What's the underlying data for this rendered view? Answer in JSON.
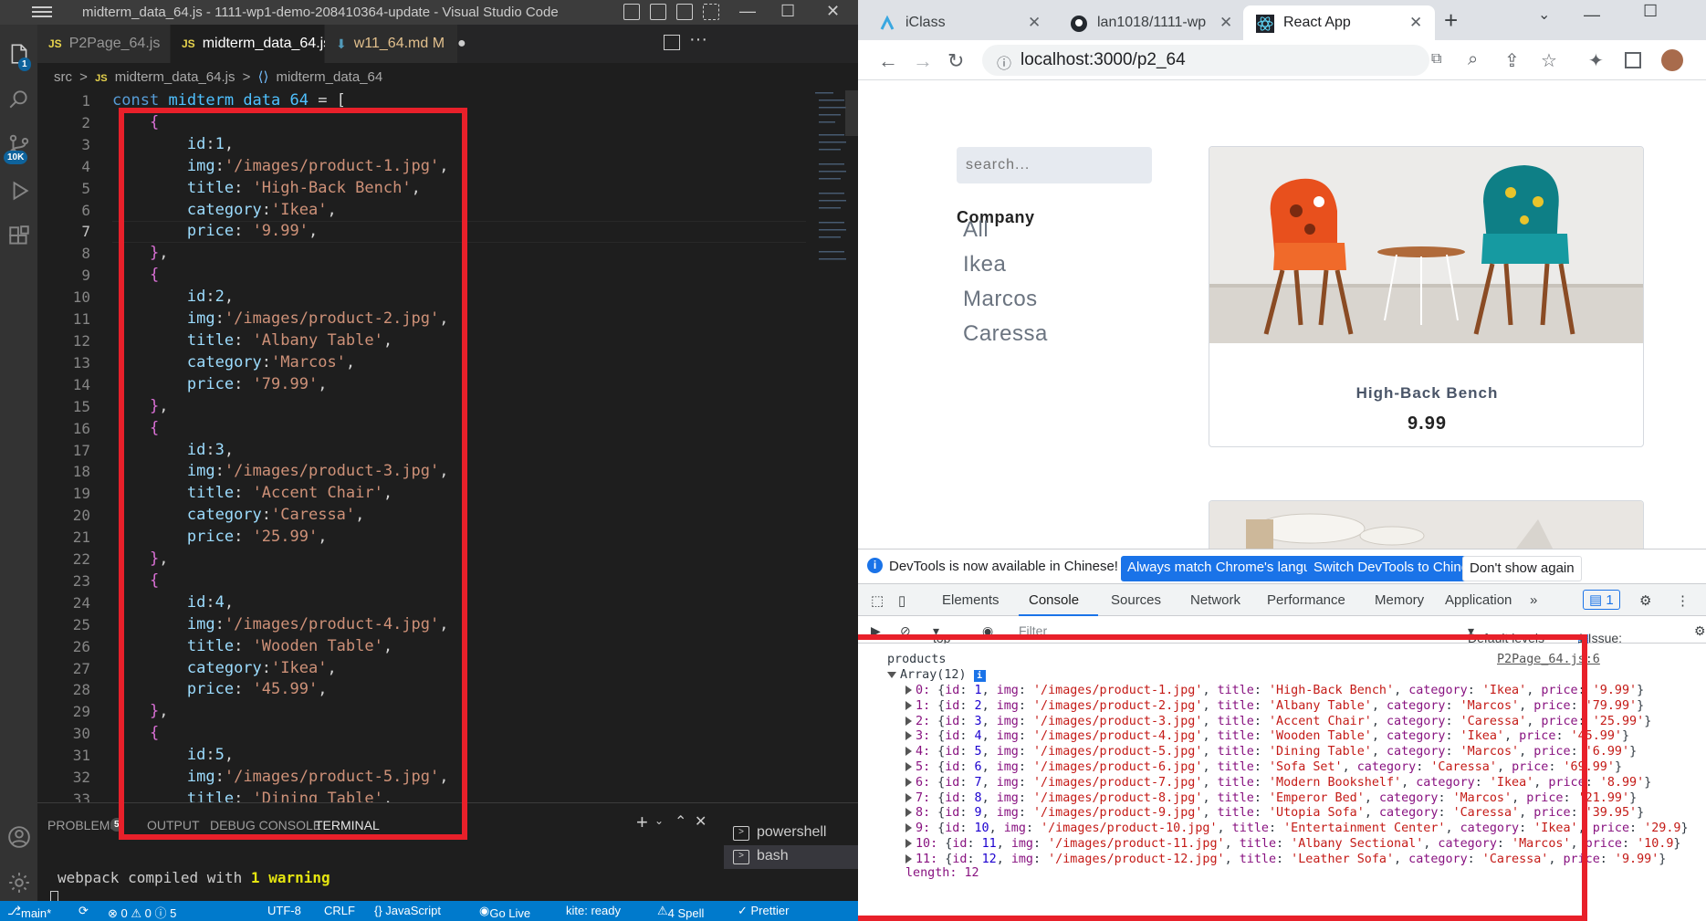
{
  "vscode": {
    "title": "midterm_data_64.js - 1111-wp1-demo-208410364-update - Visual Studio Code",
    "activity_badges": {
      "explorer": "1",
      "scm": "10K"
    },
    "tabs": [
      {
        "label": "P2Page_64.js",
        "prefix": "JS"
      },
      {
        "label": "midterm_data_64.js",
        "prefix": "JS"
      },
      {
        "label": "w11_64.md M",
        "prefix": ""
      }
    ],
    "breadcrumb": {
      "folder": "src",
      "sep": ">",
      "file": "midterm_data_64.js",
      "symbol": "midterm_data_64",
      "js": "JS"
    },
    "line_numbers": [
      "1",
      "2",
      "3",
      "4",
      "5",
      "6",
      "7",
      "8",
      "9",
      "10",
      "11",
      "12",
      "13",
      "14",
      "15",
      "16",
      "17",
      "18",
      "19",
      "20",
      "21",
      "22",
      "23",
      "24",
      "25",
      "26",
      "27",
      "28",
      "29",
      "30",
      "31",
      "32",
      "33"
    ],
    "current_line": "7",
    "code": {
      "decl_keyword": "const",
      "decl_name": "midterm_data_64",
      "decl_rest": " = [",
      "products": [
        {
          "id": "1",
          "img": "'/images/product-1.jpg'",
          "title": "'High-Back Bench'",
          "category": "'Ikea'",
          "price": "'9.99'"
        },
        {
          "id": "2",
          "img": "'/images/product-2.jpg'",
          "title": "'Albany Table'",
          "category": "'Marcos'",
          "price": "'79.99'"
        },
        {
          "id": "3",
          "img": "'/images/product-3.jpg'",
          "title": "'Accent Chair'",
          "category": "'Caressa'",
          "price": "'25.99'"
        },
        {
          "id": "4",
          "img": "'/images/product-4.jpg'",
          "title": "'Wooden Table'",
          "category": "'Ikea'",
          "price": "'45.99'"
        },
        {
          "id": "5",
          "img": "'/images/product-5.jpg'",
          "title": "'Dining Table'"
        }
      ]
    },
    "panel": {
      "tabs": [
        "PROBLEMS",
        "OUTPUT",
        "DEBUG CONSOLE",
        "TERMINAL"
      ],
      "problems_count": "5",
      "terminal_text": "webpack compiled with ",
      "terminal_warning": "1 warning",
      "shells": [
        "powershell",
        "bash"
      ]
    },
    "status": [
      "main*",
      "⊗ 0 ⚠ 0 ⓘ 5",
      "UTF-8",
      "CRLF",
      "{} JavaScript",
      "Go Live",
      "kite: ready",
      "4 Spell",
      "✓ Prettier"
    ]
  },
  "chrome": {
    "tabs": [
      {
        "label": "iClass"
      },
      {
        "label": "lan1018/1111-wp"
      },
      {
        "label": "React App"
      }
    ],
    "url": "localhost:3000/p2_64",
    "page": {
      "search_placeholder": "search...",
      "company_heading": "Company",
      "categories": [
        "All",
        "Ikea",
        "Marcos",
        "Caressa"
      ],
      "card": {
        "title": "High-Back Bench",
        "price": "9.99"
      }
    },
    "devtools": {
      "infobar_text": "DevTools is now available in Chinese!",
      "infobar_buttons": [
        "Always match Chrome's language",
        "Switch DevTools to Chinese",
        "Don't show again"
      ],
      "tabs": [
        "Elements",
        "Console",
        "Sources",
        "Network",
        "Performance",
        "Memory",
        "Application"
      ],
      "issues_badge": "1",
      "console_toolbar": {
        "context": "top",
        "filter_placeholder": "Filter",
        "levels": "Default levels",
        "issues": "1 Issue:",
        "issues_count": "1"
      },
      "log_label": "products",
      "log_source": "P2Page_64.js:6",
      "array_label": "Array(12)",
      "array_length": "length: 12",
      "items": [
        {
          "index": "0",
          "id": "1",
          "img": "'/images/product-1.jpg'",
          "title": "'High-Back Bench'",
          "category": "'Ikea'",
          "price": "'9.99'"
        },
        {
          "index": "1",
          "id": "2",
          "img": "'/images/product-2.jpg'",
          "title": "'Albany Table'",
          "category": "'Marcos'",
          "price": "'79.99'"
        },
        {
          "index": "2",
          "id": "3",
          "img": "'/images/product-3.jpg'",
          "title": "'Accent Chair'",
          "category": "'Caressa'",
          "price": "'25.99'"
        },
        {
          "index": "3",
          "id": "4",
          "img": "'/images/product-4.jpg'",
          "title": "'Wooden Table'",
          "category": "'Ikea'",
          "price": "'45.99'"
        },
        {
          "index": "4",
          "id": "5",
          "img": "'/images/product-5.jpg'",
          "title": "'Dining Table'",
          "category": "'Marcos'",
          "price": "'6.99'"
        },
        {
          "index": "5",
          "id": "6",
          "img": "'/images/product-6.jpg'",
          "title": "'Sofa Set'",
          "category": "'Caressa'",
          "price": "'69.99'"
        },
        {
          "index": "6",
          "id": "7",
          "img": "'/images/product-7.jpg'",
          "title": "'Modern Bookshelf'",
          "category": "'Ikea'",
          "price": "'8.99'"
        },
        {
          "index": "7",
          "id": "8",
          "img": "'/images/product-8.jpg'",
          "title": "'Emperor Bed'",
          "category": "'Marcos'",
          "price": "'21.99'"
        },
        {
          "index": "8",
          "id": "9",
          "img": "'/images/product-9.jpg'",
          "title": "'Utopia Sofa'",
          "category": "'Caressa'",
          "price": "'39.95'"
        },
        {
          "index": "9",
          "id": "10",
          "img": "'/images/product-10.jpg'",
          "title": "'Entertainment Center'",
          "category": "'Ikea'",
          "price": "'29.9"
        },
        {
          "index": "10",
          "id": "11",
          "img": "'/images/product-11.jpg'",
          "title": "'Albany Sectional'",
          "category": "'Marcos'",
          "price": "'10.9"
        },
        {
          "index": "11",
          "id": "12",
          "img": "'/images/product-12.jpg'",
          "title": "'Leather Sofa'",
          "category": "'Caressa'",
          "price": "'9.99'"
        }
      ]
    }
  },
  "colors": {
    "highlight_box": "#e8202a",
    "vscode_accent": "#007acc",
    "chrome_blue": "#1a73e8"
  }
}
